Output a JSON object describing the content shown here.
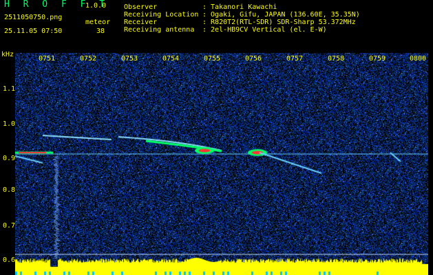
{
  "header": {
    "app_title": "H R O F F T",
    "version": "1.0.0",
    "filename": "2511050750.png",
    "datetime": "25.11.05 07:50",
    "meteor_label": "meteor",
    "meteor_count": "38"
  },
  "info": [
    {
      "label": "Observer",
      "value": ": Takanori Kawachi"
    },
    {
      "label": "Receiving Location",
      "value": ": Ogaki, Gifu, JAPAN (136.60E, 35.35N)"
    },
    {
      "label": "Receiver",
      "value": ": R820T2(RTL-SDR) SDR-Sharp 53.372MHz"
    },
    {
      "label": "Receiving antenna",
      "value": ": 2el-HB9CV Vertical (el. E-W)"
    }
  ],
  "spectrogram": {
    "y_unit": "kHz",
    "y_ticks": [
      "1.1",
      "1.0",
      "0.9",
      "0.8",
      "0.7",
      "0.6"
    ],
    "x_ticks": [
      "0751",
      "0752",
      "0753",
      "0754",
      "0755",
      "0756",
      "0757",
      "0758",
      "0759",
      "0800"
    ],
    "colors": {
      "background": "#000000",
      "noise": "#0a2a8a",
      "signal": "#00ff66",
      "strong": "#ff3333",
      "bottom_band": "#ffff00",
      "text_yellow": "#ffff00"
    }
  }
}
